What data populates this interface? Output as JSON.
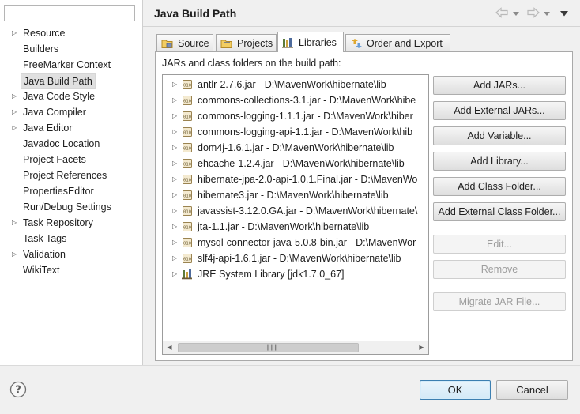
{
  "sidebar": {
    "filter_value": "",
    "items": [
      {
        "label": "Resource",
        "expandable": true
      },
      {
        "label": "Builders",
        "expandable": false
      },
      {
        "label": "FreeMarker Context",
        "expandable": false
      },
      {
        "label": "Java Build Path",
        "expandable": false,
        "selected": true
      },
      {
        "label": "Java Code Style",
        "expandable": true
      },
      {
        "label": "Java Compiler",
        "expandable": true
      },
      {
        "label": "Java Editor",
        "expandable": true
      },
      {
        "label": "Javadoc Location",
        "expandable": false
      },
      {
        "label": "Project Facets",
        "expandable": false
      },
      {
        "label": "Project References",
        "expandable": false
      },
      {
        "label": "PropertiesEditor",
        "expandable": false
      },
      {
        "label": "Run/Debug Settings",
        "expandable": false
      },
      {
        "label": "Task Repository",
        "expandable": true
      },
      {
        "label": "Task Tags",
        "expandable": false
      },
      {
        "label": "Validation",
        "expandable": true
      },
      {
        "label": "WikiText",
        "expandable": false
      }
    ]
  },
  "header": {
    "title": "Java Build Path",
    "icons": [
      "back-arrow-icon",
      "back-menu-icon",
      "forward-arrow-icon",
      "forward-menu-icon",
      "view-menu-icon"
    ]
  },
  "tabs": [
    {
      "label": "Source",
      "icon": "source-folder-icon",
      "active": false
    },
    {
      "label": "Projects",
      "icon": "projects-icon",
      "active": false
    },
    {
      "label": "Libraries",
      "icon": "libraries-icon",
      "active": true
    },
    {
      "label": "Order and Export",
      "icon": "order-export-icon",
      "active": false
    }
  ],
  "panel": {
    "caption": "JARs and class folders on the build path:",
    "libraries": [
      {
        "label": "antlr-2.7.6.jar - D:\\MavenWork\\hibernate\\lib",
        "icon": "jar-icon"
      },
      {
        "label": "commons-collections-3.1.jar - D:\\MavenWork\\hibe",
        "icon": "jar-icon"
      },
      {
        "label": "commons-logging-1.1.1.jar - D:\\MavenWork\\hiber",
        "icon": "jar-icon"
      },
      {
        "label": "commons-logging-api-1.1.jar - D:\\MavenWork\\hib",
        "icon": "jar-icon"
      },
      {
        "label": "dom4j-1.6.1.jar - D:\\MavenWork\\hibernate\\lib",
        "icon": "jar-icon"
      },
      {
        "label": "ehcache-1.2.4.jar - D:\\MavenWork\\hibernate\\lib",
        "icon": "jar-icon"
      },
      {
        "label": "hibernate-jpa-2.0-api-1.0.1.Final.jar - D:\\MavenWo",
        "icon": "jar-icon"
      },
      {
        "label": "hibernate3.jar - D:\\MavenWork\\hibernate\\lib",
        "icon": "jar-icon"
      },
      {
        "label": "javassist-3.12.0.GA.jar - D:\\MavenWork\\hibernate\\",
        "icon": "jar-icon"
      },
      {
        "label": "jta-1.1.jar - D:\\MavenWork\\hibernate\\lib",
        "icon": "jar-icon"
      },
      {
        "label": "mysql-connector-java-5.0.8-bin.jar - D:\\MavenWor",
        "icon": "jar-icon"
      },
      {
        "label": "slf4j-api-1.6.1.jar - D:\\MavenWork\\hibernate\\lib",
        "icon": "jar-icon"
      },
      {
        "label": "JRE System Library [jdk1.7.0_67]",
        "icon": "jre-library-icon"
      }
    ],
    "buttons": [
      {
        "label": "Add JARs...",
        "enabled": true
      },
      {
        "label": "Add External JARs...",
        "enabled": true
      },
      {
        "label": "Add Variable...",
        "enabled": true
      },
      {
        "label": "Add Library...",
        "enabled": true
      },
      {
        "label": "Add Class Folder...",
        "enabled": true
      },
      {
        "label": "Add External Class Folder...",
        "enabled": true
      },
      {
        "label": "Edit...",
        "enabled": false
      },
      {
        "label": "Remove",
        "enabled": false
      },
      {
        "label": "Migrate JAR File...",
        "enabled": false
      }
    ]
  },
  "footer": {
    "ok_label": "OK",
    "cancel_label": "Cancel",
    "help_icon": "help-icon"
  },
  "colors": {
    "accent_border": "#3c7fb1",
    "selected_item_bg": "#e0e0e0",
    "disabled_text": "#9d9d9d"
  }
}
